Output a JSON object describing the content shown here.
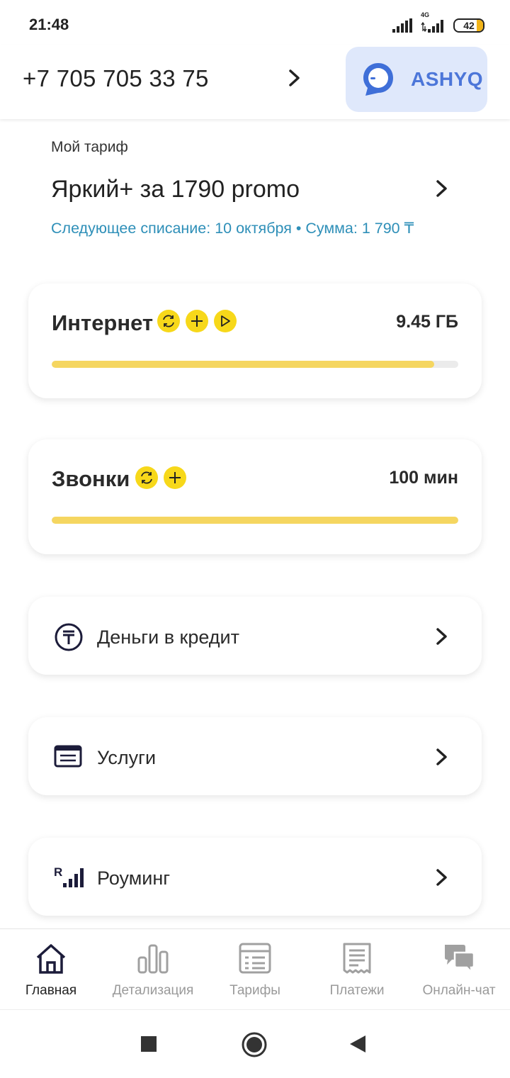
{
  "status_bar": {
    "time": "21:48",
    "network_type": "4G",
    "battery": "42",
    "battery_color": "#f2b418"
  },
  "header": {
    "phone": "+7 705 705 33 75",
    "ashyq_label": "ASHYQ",
    "ashyq_bg": "#dfe8fb",
    "ashyq_color": "#4c76d9"
  },
  "tariff": {
    "caption": "Мой тариф",
    "name": "Яркий+ за 1790 promo",
    "next_charge": "Следующее списание: 10 октября  • Сумма: 1 790 ₸"
  },
  "internet": {
    "title": "Интернет",
    "value": "9.45 ГБ",
    "remaining_fraction": 0.94,
    "icons": [
      "refresh-icon",
      "plus-icon",
      "play-icon"
    ]
  },
  "calls": {
    "title": "Звонки",
    "value": "100 мин",
    "remaining_fraction": 1.0,
    "icons": [
      "refresh-icon",
      "plus-icon"
    ]
  },
  "rows": [
    {
      "label": "Деньги в кредит",
      "icon": "tenge-icon"
    },
    {
      "label": "Услуги",
      "icon": "services-icon"
    },
    {
      "label": "Роуминг",
      "icon": "roaming-icon"
    }
  ],
  "nav": [
    {
      "label": "Главная",
      "icon": "home-icon",
      "active": true
    },
    {
      "label": "Детализация",
      "icon": "bar-chart-icon",
      "active": false
    },
    {
      "label": "Тарифы",
      "icon": "tariffs-icon",
      "active": false
    },
    {
      "label": "Платежи",
      "icon": "receipt-icon",
      "active": false
    },
    {
      "label": "Онлайн-чат",
      "icon": "chat-icon",
      "active": false
    }
  ],
  "colors": {
    "accent_yellow": "#f7d81a",
    "bar_yellow": "#f5d660",
    "link_blue": "#2e8fb8",
    "dark_navy": "#1c1c3a"
  }
}
